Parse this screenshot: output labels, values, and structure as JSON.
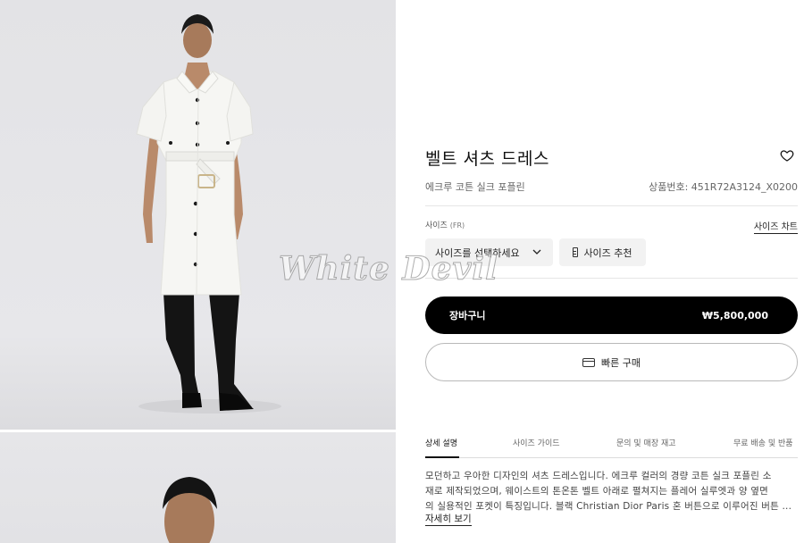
{
  "product": {
    "title": "벨트 셔츠 드레스",
    "subtitle": "에크루 코튼 실크 포플린",
    "sku": "상품번호: 451R72A3124_X0200"
  },
  "icons": {
    "wishlist": "heart-icon",
    "size_dropdown": "chevron-down-icon",
    "size_reco": "ruler-icon",
    "quick_buy": "card-icon"
  },
  "size": {
    "label": "사이즈",
    "unit": "(FR)",
    "chart_link": "사이즈 차트",
    "select_placeholder": "사이즈를 선택하세요",
    "recommend_label": "사이즈 추천"
  },
  "actions": {
    "cart_label": "장바구니",
    "price": "₩5,800,000",
    "quick_buy_label": "빠른 구매"
  },
  "tabs": [
    {
      "label": "상세 설명",
      "active": true
    },
    {
      "label": "사이즈 가이드",
      "active": false
    },
    {
      "label": "문의 및 매장 재고",
      "active": false
    },
    {
      "label": "무료 배송 및 반품",
      "active": false
    }
  ],
  "description": {
    "lines": [
      "모던하고 우아한 디자인의 셔츠 드레스입니다. 에크루 컬러의 경량 코튼 실크 포플린 소",
      "재로 제작되었으며, 웨이스트의 톤온톤 벨트 아래로 펼쳐지는 플레어 실루엣과 양 옆면",
      "의 실용적인 포켓이 특징입니다. 블랙 Christian Dior Paris 혼 버튼으로 이루어진 버튼 ..."
    ],
    "more_link": "자세히 보기"
  },
  "watermark": "White Devil",
  "colors": {
    "primary_button": "#000000",
    "photo_background": "#e6e6e9",
    "dress": "#f6f6f3"
  }
}
